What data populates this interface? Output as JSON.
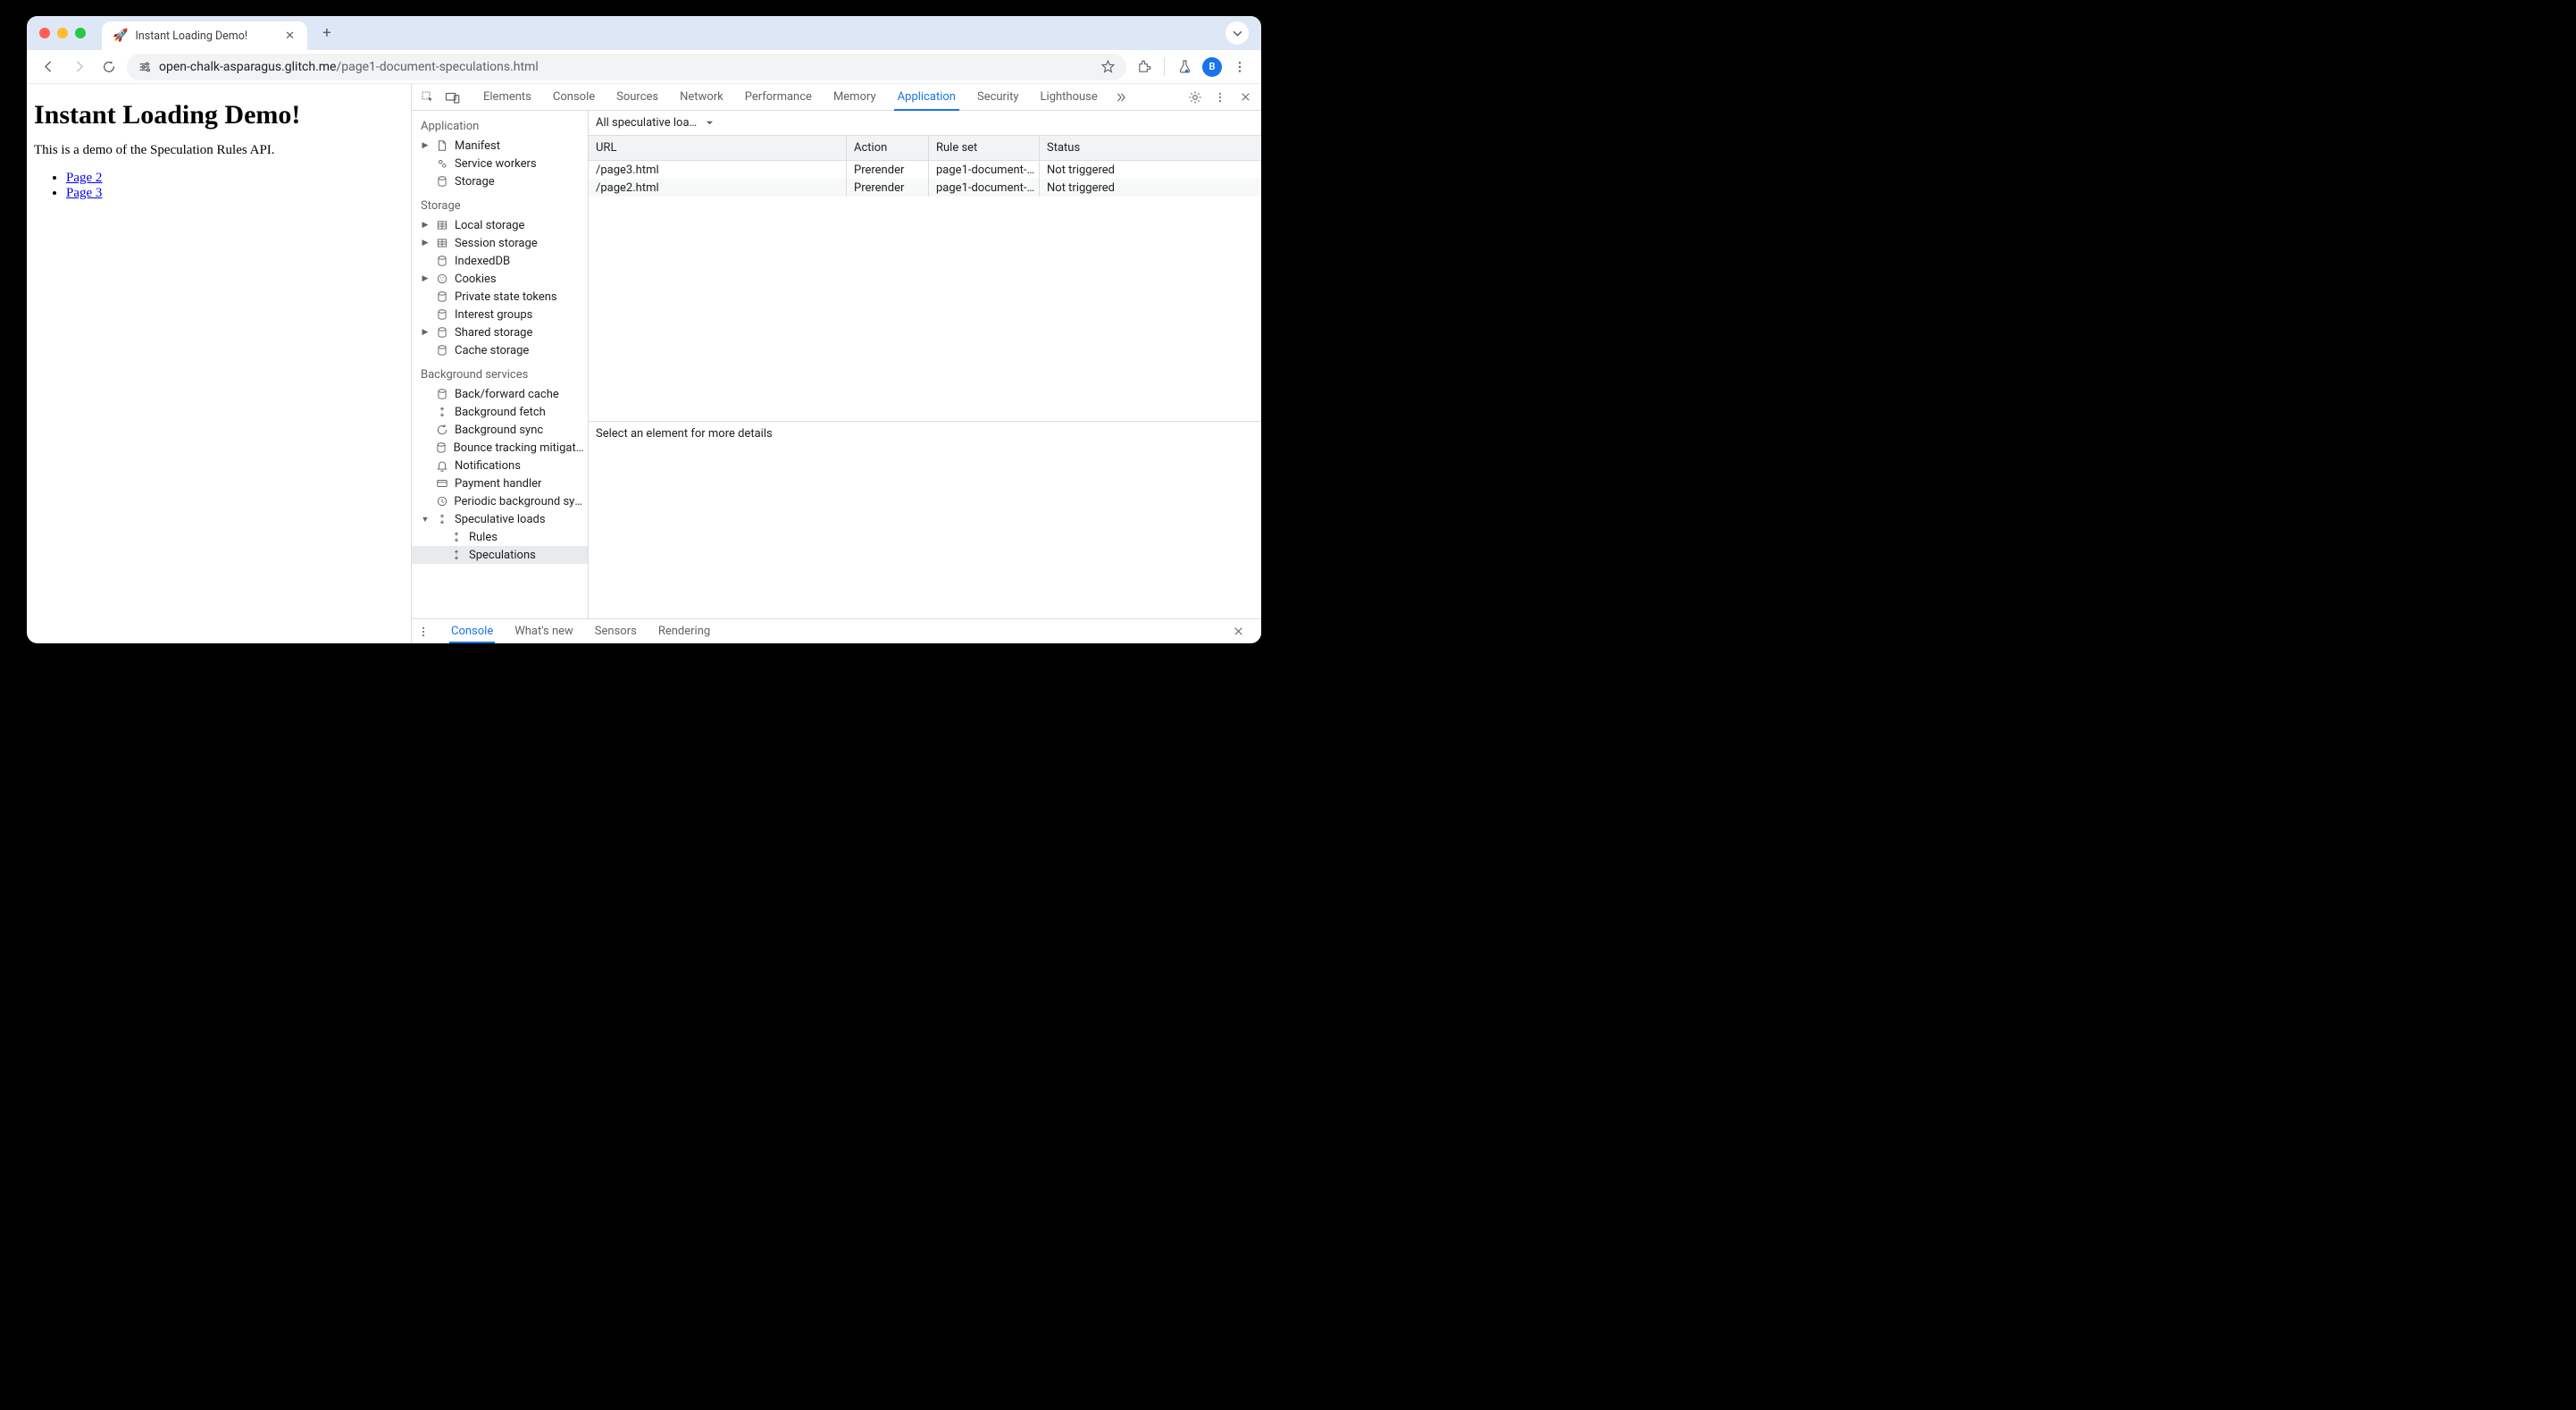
{
  "tab": {
    "favicon": "🚀",
    "title": "Instant Loading Demo!"
  },
  "url": {
    "domain": "open-chalk-asparagus.glitch.me",
    "path": "/page1-document-speculations.html"
  },
  "avatar_letter": "B",
  "page": {
    "heading": "Instant Loading Demo!",
    "paragraph": "This is a demo of the Speculation Rules API.",
    "links": [
      "Page 2",
      "Page 3"
    ]
  },
  "devtools": {
    "tabs": [
      "Elements",
      "Console",
      "Sources",
      "Network",
      "Performance",
      "Memory",
      "Application",
      "Security",
      "Lighthouse"
    ],
    "active_tab": "Application",
    "sidebar": {
      "sections": [
        {
          "title": "Application",
          "items": [
            {
              "label": "Manifest",
              "icon": "file",
              "expandable": true
            },
            {
              "label": "Service workers",
              "icon": "gears"
            },
            {
              "label": "Storage",
              "icon": "cylinder"
            }
          ]
        },
        {
          "title": "Storage",
          "items": [
            {
              "label": "Local storage",
              "icon": "table",
              "expandable": true
            },
            {
              "label": "Session storage",
              "icon": "table",
              "expandable": true
            },
            {
              "label": "IndexedDB",
              "icon": "cylinder"
            },
            {
              "label": "Cookies",
              "icon": "cookie",
              "expandable": true
            },
            {
              "label": "Private state tokens",
              "icon": "cylinder"
            },
            {
              "label": "Interest groups",
              "icon": "cylinder"
            },
            {
              "label": "Shared storage",
              "icon": "cylinder",
              "expandable": true
            },
            {
              "label": "Cache storage",
              "icon": "cylinder"
            }
          ]
        },
        {
          "title": "Background services",
          "items": [
            {
              "label": "Back/forward cache",
              "icon": "cylinder"
            },
            {
              "label": "Background fetch",
              "icon": "sync"
            },
            {
              "label": "Background sync",
              "icon": "refresh"
            },
            {
              "label": "Bounce tracking mitigation",
              "icon": "cylinder"
            },
            {
              "label": "Notifications",
              "icon": "bell"
            },
            {
              "label": "Payment handler",
              "icon": "card"
            },
            {
              "label": "Periodic background sync",
              "icon": "clock"
            },
            {
              "label": "Speculative loads",
              "icon": "sync",
              "expandable": true,
              "expanded": true,
              "children": [
                {
                  "label": "Rules",
                  "icon": "sync"
                },
                {
                  "label": "Speculations",
                  "icon": "sync",
                  "selected": true
                }
              ]
            }
          ]
        }
      ]
    },
    "filter": "All speculative loa…",
    "table": {
      "headers": [
        "URL",
        "Action",
        "Rule set",
        "Status"
      ],
      "rows": [
        {
          "url": "/page3.html",
          "action": "Prerender",
          "ruleset": "page1-document-…",
          "status": "Not triggered"
        },
        {
          "url": "/page2.html",
          "action": "Prerender",
          "ruleset": "page1-document-…",
          "status": "Not triggered"
        }
      ]
    },
    "detail_hint": "Select an element for more details",
    "drawer_tabs": [
      "Console",
      "What's new",
      "Sensors",
      "Rendering"
    ],
    "drawer_active": "Console"
  }
}
